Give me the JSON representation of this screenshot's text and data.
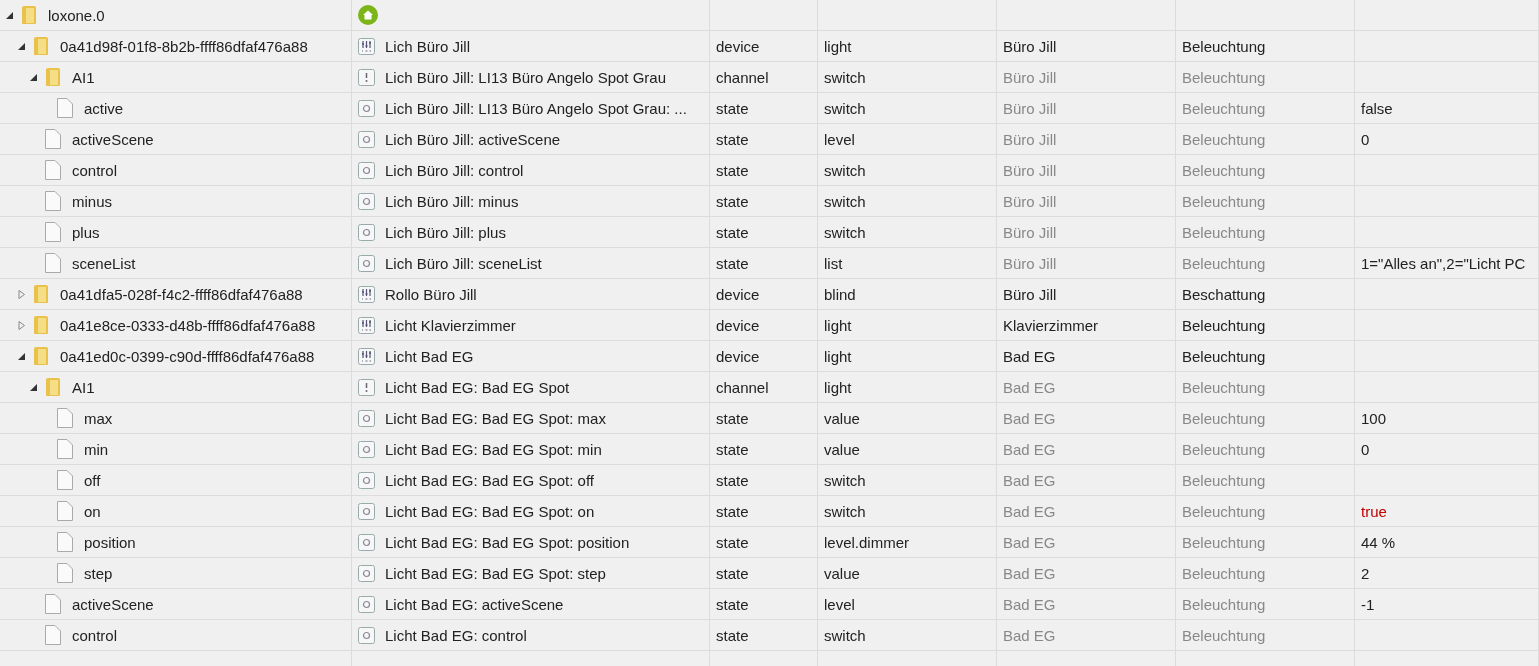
{
  "tree": [
    {
      "name": "loxone.0",
      "kind": "instance",
      "expanded": true,
      "children": [
        {
          "name": "0a41d98f-01f8-8b2b-ffff86dfaf476a88",
          "kind": "device",
          "expanded": true,
          "title": "Lich Büro Jill",
          "type": "device",
          "role": "light",
          "room": "Büro Jill",
          "function": "Beleuchtung",
          "inherited": false,
          "children": [
            {
              "name": "AI1",
              "kind": "channel",
              "expanded": true,
              "title": "Lich Büro Jill: LI13 Büro Angelo Spot Grau",
              "type": "channel",
              "role": "switch",
              "room": "Büro Jill",
              "function": "Beleuchtung",
              "inherited": true,
              "children": [
                {
                  "name": "active",
                  "kind": "state",
                  "title": "Lich Büro Jill: LI13 Büro Angelo Spot Grau: ...",
                  "type": "state",
                  "role": "switch",
                  "room": "Büro Jill",
                  "function": "Beleuchtung",
                  "inherited": true,
                  "value": "false",
                  "acknowledged": true
                }
              ]
            },
            {
              "name": "activeScene",
              "kind": "state",
              "title": "Lich Büro Jill: activeScene",
              "type": "state",
              "role": "level",
              "room": "Büro Jill",
              "function": "Beleuchtung",
              "inherited": true,
              "value": "0",
              "acknowledged": true
            },
            {
              "name": "control",
              "kind": "state",
              "title": "Lich Büro Jill: control",
              "type": "state",
              "role": "switch",
              "room": "Büro Jill",
              "function": "Beleuchtung",
              "inherited": true
            },
            {
              "name": "minus",
              "kind": "state",
              "title": "Lich Büro Jill: minus",
              "type": "state",
              "role": "switch",
              "room": "Büro Jill",
              "function": "Beleuchtung",
              "inherited": true
            },
            {
              "name": "plus",
              "kind": "state",
              "title": "Lich Büro Jill: plus",
              "type": "state",
              "role": "switch",
              "room": "Büro Jill",
              "function": "Beleuchtung",
              "inherited": true
            },
            {
              "name": "sceneList",
              "kind": "state",
              "title": "Lich Büro Jill: sceneList",
              "type": "state",
              "role": "list",
              "room": "Büro Jill",
              "function": "Beleuchtung",
              "inherited": true,
              "value": "1=\"Alles an\",2=\"Licht PC",
              "acknowledged": true
            }
          ]
        },
        {
          "name": "0a41dfa5-028f-f4c2-ffff86dfaf476a88",
          "kind": "device",
          "expanded": false,
          "title": "Rollo Büro Jill",
          "type": "device",
          "role": "blind",
          "room": "Büro Jill",
          "function": "Beschattung",
          "inherited": false
        },
        {
          "name": "0a41e8ce-0333-d48b-ffff86dfaf476a88",
          "kind": "device",
          "expanded": false,
          "title": "Licht Klavierzimmer",
          "type": "device",
          "role": "light",
          "room": "Klavierzimmer",
          "function": "Beleuchtung",
          "inherited": false
        },
        {
          "name": "0a41ed0c-0399-c90d-ffff86dfaf476a88",
          "kind": "device",
          "expanded": true,
          "title": "Licht Bad EG",
          "type": "device",
          "role": "light",
          "room": "Bad EG",
          "function": "Beleuchtung",
          "inherited": false,
          "children": [
            {
              "name": "AI1",
              "kind": "channel",
              "expanded": true,
              "title": "Licht Bad EG: Bad EG Spot",
              "type": "channel",
              "role": "light",
              "room": "Bad EG",
              "function": "Beleuchtung",
              "inherited": true,
              "children": [
                {
                  "name": "max",
                  "kind": "state",
                  "title": "Licht Bad EG: Bad EG Spot: max",
                  "type": "state",
                  "role": "value",
                  "room": "Bad EG",
                  "function": "Beleuchtung",
                  "inherited": true,
                  "value": "100",
                  "acknowledged": true
                },
                {
                  "name": "min",
                  "kind": "state",
                  "title": "Licht Bad EG: Bad EG Spot: min",
                  "type": "state",
                  "role": "value",
                  "room": "Bad EG",
                  "function": "Beleuchtung",
                  "inherited": true,
                  "value": "0",
                  "acknowledged": true
                },
                {
                  "name": "off",
                  "kind": "state",
                  "title": "Licht Bad EG: Bad EG Spot: off",
                  "type": "state",
                  "role": "switch",
                  "room": "Bad EG",
                  "function": "Beleuchtung",
                  "inherited": true
                },
                {
                  "name": "on",
                  "kind": "state",
                  "title": "Licht Bad EG: Bad EG Spot: on",
                  "type": "state",
                  "role": "switch",
                  "room": "Bad EG",
                  "function": "Beleuchtung",
                  "inherited": true,
                  "value": "true",
                  "acknowledged": false
                },
                {
                  "name": "position",
                  "kind": "state",
                  "title": "Licht Bad EG: Bad EG Spot: position",
                  "type": "state",
                  "role": "level.dimmer",
                  "room": "Bad EG",
                  "function": "Beleuchtung",
                  "inherited": true,
                  "value": "44 %",
                  "acknowledged": true
                },
                {
                  "name": "step",
                  "kind": "state",
                  "title": "Licht Bad EG: Bad EG Spot: step",
                  "type": "state",
                  "role": "value",
                  "room": "Bad EG",
                  "function": "Beleuchtung",
                  "inherited": true,
                  "value": "2",
                  "acknowledged": true
                }
              ]
            },
            {
              "name": "activeScene",
              "kind": "state",
              "title": "Licht Bad EG: activeScene",
              "type": "state",
              "role": "level",
              "room": "Bad EG",
              "function": "Beleuchtung",
              "inherited": true,
              "value": "-1",
              "acknowledged": true
            },
            {
              "name": "control",
              "kind": "state",
              "title": "Licht Bad EG: control",
              "type": "state",
              "role": "switch",
              "room": "Bad EG",
              "function": "Beleuchtung",
              "inherited": true
            }
          ]
        }
      ]
    }
  ]
}
